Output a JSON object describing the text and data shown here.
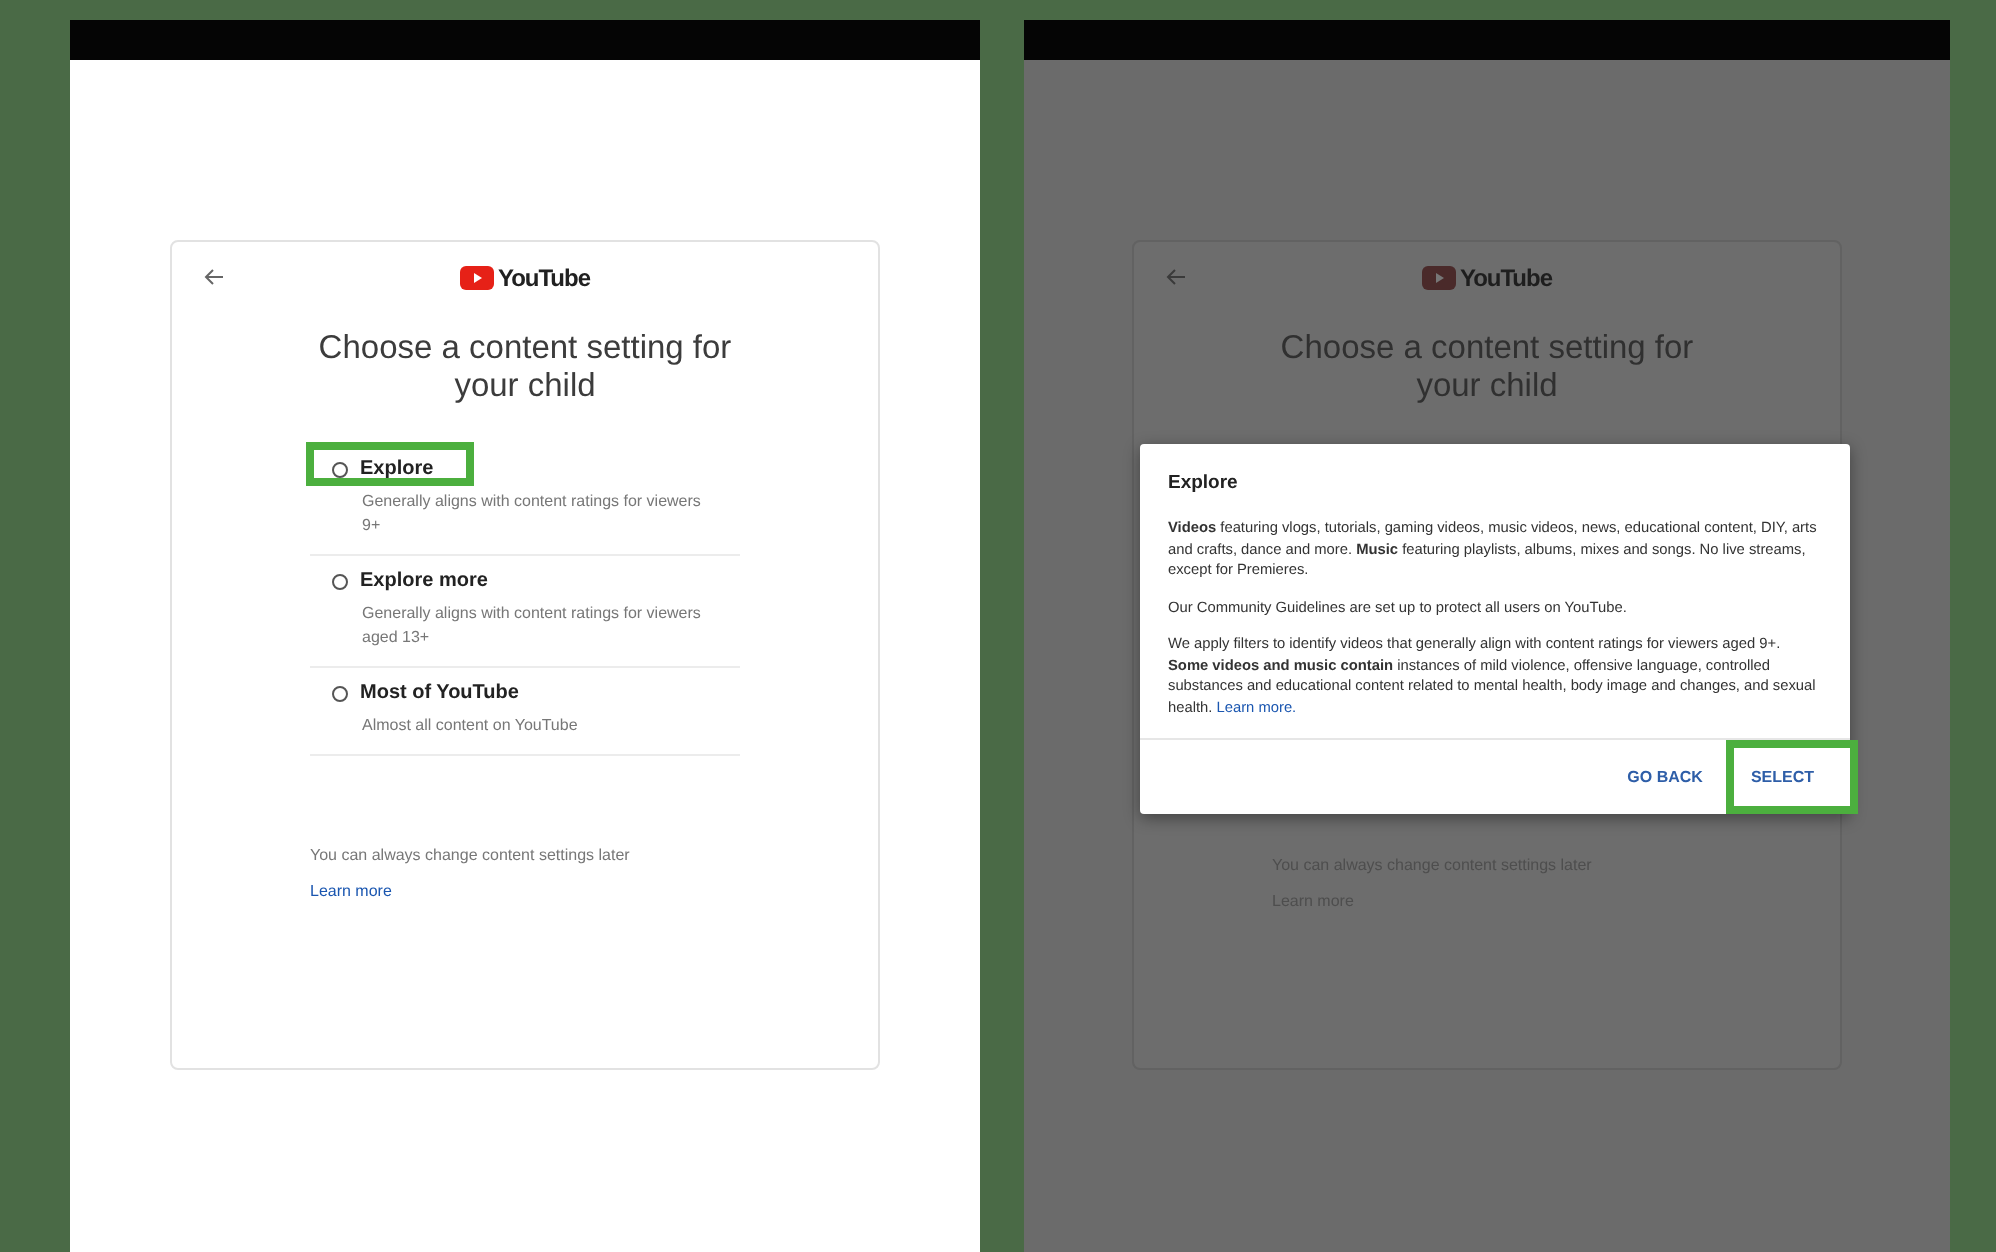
{
  "left_screen": {
    "logo": "YouTube",
    "title": "Choose a content setting for your child",
    "options": [
      {
        "label": "Explore",
        "description": "Generally aligns with content ratings for viewers 9+",
        "selected": false,
        "highlighted": true
      },
      {
        "label": "Explore more",
        "description": "Generally aligns with content ratings for viewers aged 13+",
        "selected": false,
        "highlighted": false
      },
      {
        "label": "Most of YouTube",
        "description": "Almost all content on YouTube",
        "selected": false,
        "highlighted": false
      }
    ],
    "footer_note": "You can always change content settings later",
    "learn_more": "Learn more"
  },
  "right_screen": {
    "background": {
      "logo": "YouTube",
      "title": "Choose a content setting for your child",
      "footer_note": "You can always change content settings later",
      "learn_more": "Learn more"
    },
    "dialog": {
      "title": "Explore",
      "paragraphs": [
        "**Videos** featuring vlogs, tutorials, gaming videos, music videos, news, educational content, DIY, arts and crafts, dance and more. **Music** featuring playlists, albums, mixes and songs. No live streams, except for Premieres.",
        "Our Community Guidelines are set up to protect all users on YouTube.",
        "We apply filters to identify videos that generally align with content ratings for viewers aged 9+. **Some videos and music contain** instances of mild violence, offensive language, controlled substances and educational content related to mental health, body image and changes, and sexual health."
      ],
      "link": "Learn more.",
      "buttons": [
        {
          "label": "GO BACK",
          "highlighted": false
        },
        {
          "label": "SELECT",
          "highlighted": true
        }
      ]
    }
  }
}
